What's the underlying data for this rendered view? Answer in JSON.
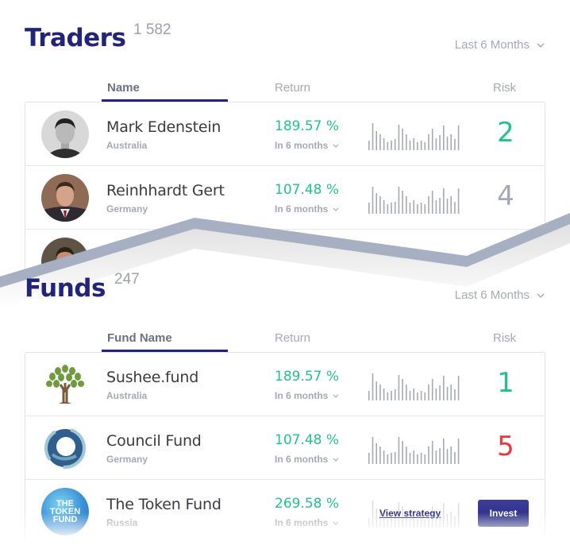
{
  "traders": {
    "title": "Traders",
    "count": "1 582",
    "period": "Last 6 Months",
    "columns": {
      "name": "Name",
      "return": "Return",
      "risk": "Risk"
    },
    "rows": [
      {
        "name": "Mark Edenstein",
        "country": "Australia",
        "return": "189.57 %",
        "period": "In 6 months",
        "risk": "2",
        "risk_color": "#22c28a",
        "avatar": "portrait-photo"
      },
      {
        "name": "Reinhhardt Gert",
        "country": "Germany",
        "return": "107.48 %",
        "period": "In 6 months",
        "risk": "4",
        "risk_color": "#a4a9b5",
        "avatar": "portrait-photo"
      },
      {
        "avatar": "portrait-photo"
      }
    ]
  },
  "funds": {
    "title": "Funds",
    "count": "247",
    "period": "Last 6 Months",
    "columns": {
      "name": "Fund Name",
      "return": "Return",
      "risk": "Risk"
    },
    "rows": [
      {
        "name": "Sushee.fund",
        "country": "Australia",
        "return": "189.57 %",
        "period": "In 6 months",
        "risk": "1",
        "risk_color": "#22c28a",
        "logo": "tree-logo"
      },
      {
        "name": "Council Fund",
        "country": "Germany",
        "return": "107.48 %",
        "period": "In 6 months",
        "risk": "5",
        "risk_color": "#e0393e",
        "logo": "swirl-logo"
      },
      {
        "name": "The Token Fund",
        "country": "Russia",
        "return": "269.58 %",
        "period": "In 6 months",
        "logo": "token-fund-logo",
        "logo_text": [
          "THE",
          "TOKEN",
          "FUND"
        ],
        "view_strategy": "View strategy",
        "invest": "Invest"
      }
    ]
  },
  "colors": {
    "brand": "#23237a",
    "positive": "#22c28a",
    "negative": "#e0393e",
    "muted": "#a4a9b5",
    "divider": "#a7b0c2"
  }
}
